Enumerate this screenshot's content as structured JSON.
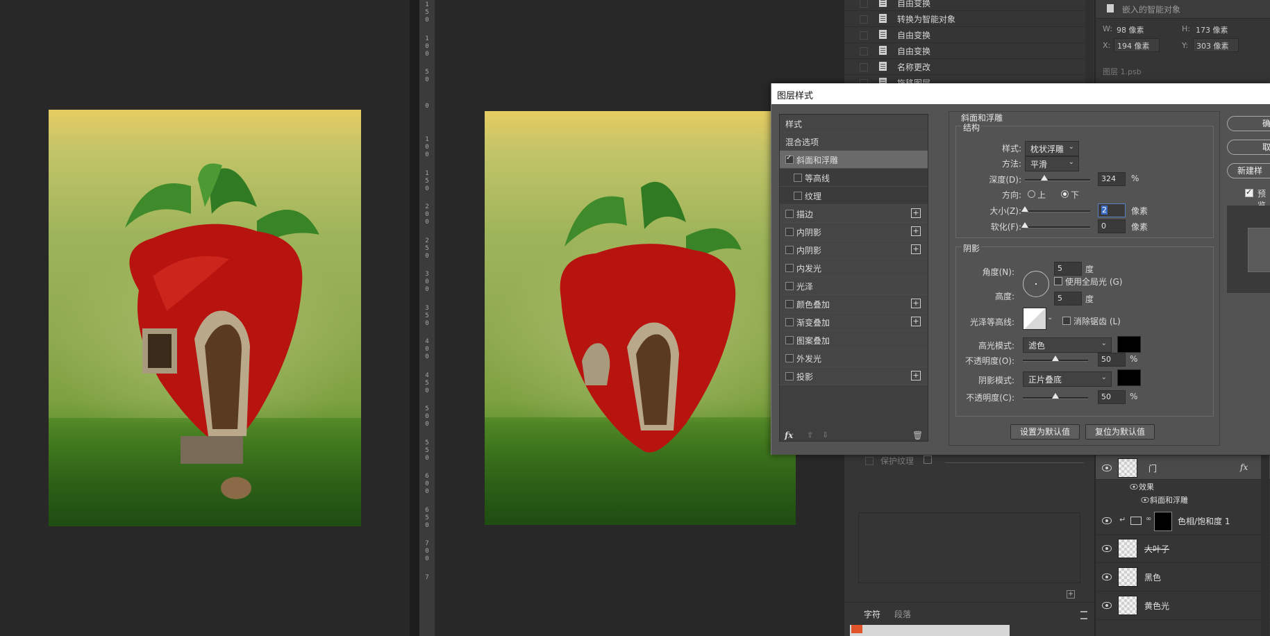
{
  "history": {
    "items": [
      {
        "label": "自由变换"
      },
      {
        "label": "转换为智能对象"
      },
      {
        "label": "自由变换"
      },
      {
        "label": "自由变换"
      },
      {
        "label": "名称更改"
      },
      {
        "label": "拖移图层"
      }
    ]
  },
  "properties": {
    "header": "嵌入的智能对象",
    "w_label": "W:",
    "w_value": "98 像素",
    "h_label": "H:",
    "h_value": "173 像素",
    "x_label": "X:",
    "x_value": "194 像素",
    "y_label": "Y:",
    "y_value": "303 像素",
    "file": "图层 1.psb"
  },
  "ruler_ticks": [
    {
      "label": "1\n5\n0"
    },
    {
      "label": "1\n0\n0"
    },
    {
      "label": "5\n0"
    },
    {
      "label": "0"
    },
    {
      "label": "1\n0\n0"
    },
    {
      "label": "1\n5\n0"
    },
    {
      "label": "2\n0\n0"
    },
    {
      "label": "2\n5\n0"
    },
    {
      "label": "3\n0\n0"
    },
    {
      "label": "3\n5\n0"
    },
    {
      "label": "4\n0\n0"
    },
    {
      "label": "4\n5\n0"
    },
    {
      "label": "5\n0\n0"
    },
    {
      "label": "5\n5\n0"
    },
    {
      "label": "6\n0\n0"
    },
    {
      "label": "6\n5\n0"
    },
    {
      "label": "7\n0\n0"
    },
    {
      "label": "7"
    }
  ],
  "dialog": {
    "title": "图层样式",
    "styles_header": "样式",
    "blend_options": "混合选项",
    "style_items": [
      {
        "label": "斜面和浮雕",
        "checked": true,
        "plus": false
      },
      {
        "label": "等高线",
        "checked": false,
        "plus": false
      },
      {
        "label": "纹理",
        "checked": false,
        "plus": false
      },
      {
        "label": "描边",
        "checked": false,
        "plus": true
      },
      {
        "label": "内阴影",
        "checked": false,
        "plus": true
      },
      {
        "label": "内阴影",
        "checked": false,
        "plus": true
      },
      {
        "label": "内发光",
        "checked": false,
        "plus": false
      },
      {
        "label": "光泽",
        "checked": false,
        "plus": false
      },
      {
        "label": "颜色叠加",
        "checked": false,
        "plus": true
      },
      {
        "label": "渐变叠加",
        "checked": false,
        "plus": true
      },
      {
        "label": "图案叠加",
        "checked": false,
        "plus": false
      },
      {
        "label": "外发光",
        "checked": false,
        "plus": false
      },
      {
        "label": "投影",
        "checked": false,
        "plus": true
      }
    ],
    "fx_label": "fx",
    "bevel": {
      "section_title": "斜面和浮雕",
      "structure_title": "结构",
      "style_label": "样式:",
      "style_value": "枕状浮雕",
      "technique_label": "方法:",
      "technique_value": "平滑",
      "depth_label": "深度(D):",
      "depth_value": "324",
      "depth_unit": "%",
      "depth_level": 0.3,
      "direction_label": "方向:",
      "dir_up": "上",
      "dir_down": "下",
      "dir_selected": "下",
      "size_label": "大小(Z):",
      "size_value": "2",
      "size_unit": "像素",
      "size_level": 0.0,
      "soften_label": "软化(F):",
      "soften_value": "0",
      "soften_unit": "像素",
      "soften_level": 0.0
    },
    "shading": {
      "title": "阴影",
      "angle_label": "角度(N):",
      "angle_value": "5",
      "angle_unit": "度",
      "global_light": "使用全局光 (G)",
      "altitude_label": "高度:",
      "altitude_value": "5",
      "altitude_unit": "度",
      "gloss_label": "光泽等高线:",
      "antialias": "消除锯齿 (L)",
      "highlight_label": "高光模式:",
      "highlight_value": "滤色",
      "highlight_color": "#000000",
      "hl_opacity_label": "不透明度(O):",
      "hl_opacity_value": "50",
      "hl_opacity_unit": "%",
      "hl_opacity_level": 0.5,
      "shadow_label": "阴影模式:",
      "shadow_value": "正片叠底",
      "shadow_color": "#000000",
      "sh_opacity_label": "不透明度(C):",
      "sh_opacity_value": "50",
      "sh_opacity_unit": "%",
      "sh_opacity_level": 0.5
    },
    "make_default": "设置为默认值",
    "reset_default": "复位为默认值",
    "ok": "确",
    "cancel": "取",
    "new_style": "新建样",
    "preview": "预览"
  },
  "lower_panel": {
    "protect_texture": "保护纹理",
    "tab_char": "字符",
    "tab_para": "段落"
  },
  "layers": {
    "items": [
      {
        "name": "门",
        "fx": "fx",
        "effects": "效果",
        "effect_item": "斜面和浮雕"
      },
      {
        "name": "色相/饱和度 1"
      },
      {
        "name": "大叶子"
      },
      {
        "name": "黑色"
      },
      {
        "name": "黄色光"
      }
    ]
  }
}
